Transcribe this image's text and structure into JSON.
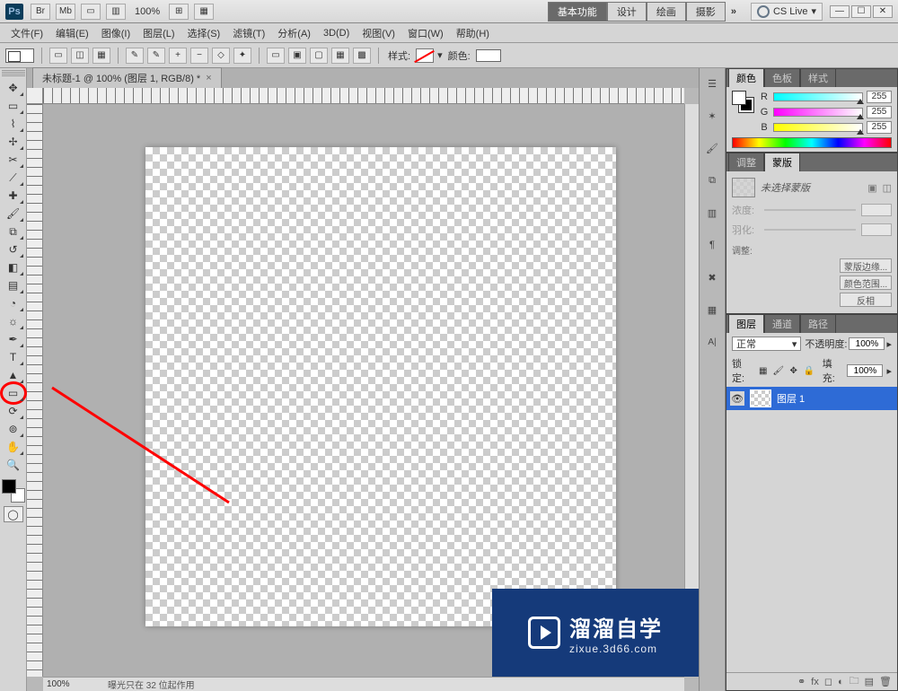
{
  "titlebar": {
    "zoom": "100%",
    "workspaces": [
      "基本功能",
      "设计",
      "绘画",
      "摄影"
    ],
    "more": "»",
    "cslive": "CS Live"
  },
  "menu": {
    "file": "文件(F)",
    "edit": "编辑(E)",
    "image": "图像(I)",
    "layer": "图层(L)",
    "select": "选择(S)",
    "filter": "滤镜(T)",
    "analysis": "分析(A)",
    "threed": "3D(D)",
    "view": "视图(V)",
    "window": "窗口(W)",
    "help": "帮助(H)"
  },
  "options": {
    "style_label": "样式:",
    "color_label": "颜色:"
  },
  "document": {
    "tab_title": "未标题-1 @ 100% (图层 1, RGB/8) *"
  },
  "statusbar": {
    "zoom": "100%",
    "message": "曝光只在 32 位起作用"
  },
  "color_panel": {
    "tab_color": "颜色",
    "tab_swatches": "色板",
    "tab_styles": "样式",
    "r_label": "R",
    "g_label": "G",
    "b_label": "B",
    "r": "255",
    "g": "255",
    "b": "255"
  },
  "mask_panel": {
    "tab_adjust": "调整",
    "tab_mask": "蒙版",
    "no_selection": "未选择蒙版",
    "density": "浓度:",
    "feather": "羽化:",
    "section": "调整:",
    "btn_edge": "蒙版边缘...",
    "btn_range": "颜色范围...",
    "btn_invert": "反相"
  },
  "layers_panel": {
    "tab_layers": "图层",
    "tab_channels": "通道",
    "tab_paths": "路径",
    "blend": "正常",
    "opacity_label": "不透明度:",
    "opacity": "100%",
    "lock_label": "锁定:",
    "fill_label": "填充:",
    "fill": "100%",
    "layer1": "图层 1"
  },
  "watermark": {
    "cn": "溜溜自学",
    "url": "zixue.3d66.com"
  }
}
